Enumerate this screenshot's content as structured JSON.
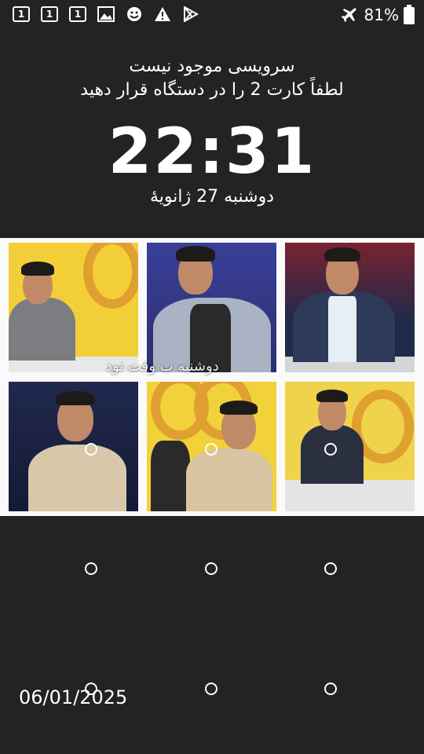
{
  "status_bar": {
    "sim_labels": [
      "1",
      "1",
      "1"
    ],
    "battery_percent": "81%"
  },
  "lock": {
    "no_service": "سرویسی موجود نیست",
    "insert_card": "لطفاً کارت 2 را در دستگاه قرار دهید",
    "time": "22:31",
    "date": "دوشنبه 27 ژانویهٔ"
  },
  "wallpaper": {
    "overlay_text": "دوشنبه ب وقت تود"
  },
  "date_stamp": "06/01/2025"
}
